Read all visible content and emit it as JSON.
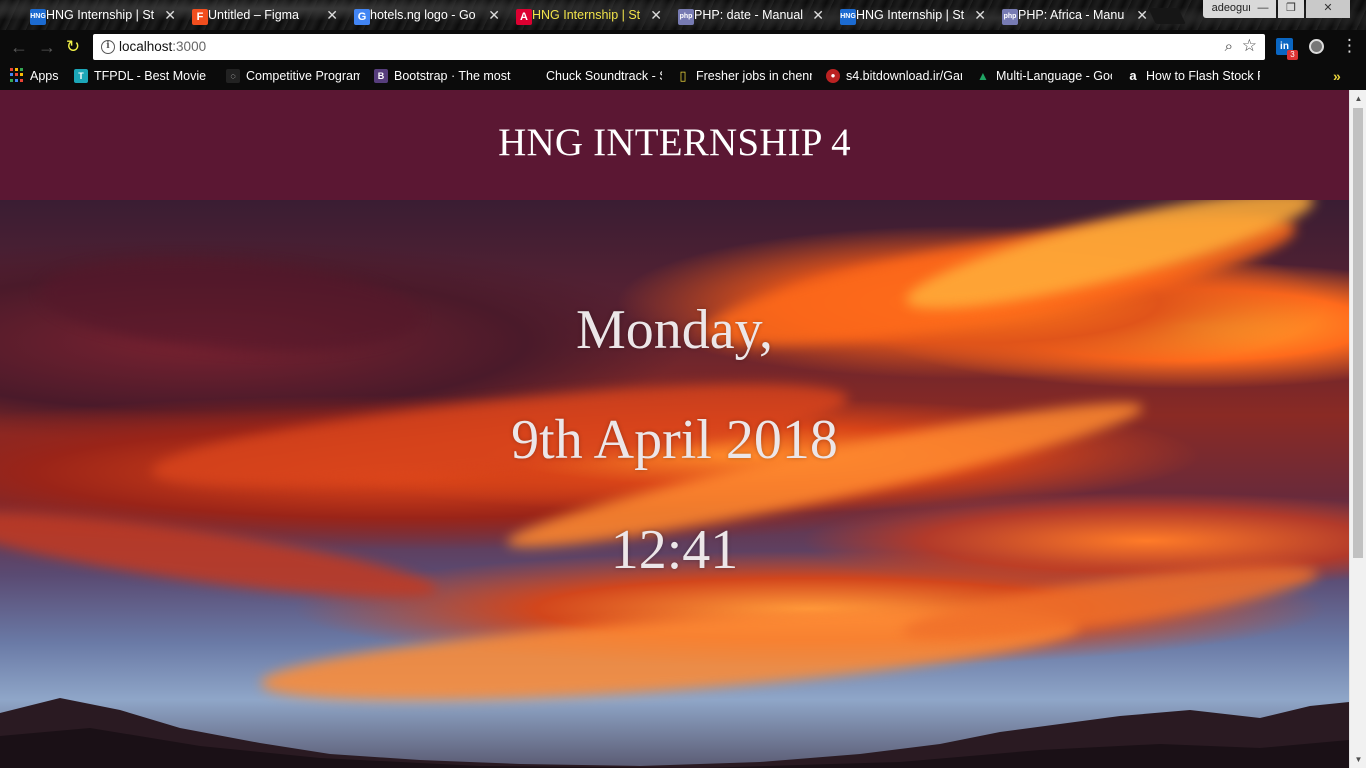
{
  "browser": {
    "tabs": [
      {
        "title": "HNG Internship | St",
        "favicon": "hng-favicon",
        "fav_color": "#1c6bd1",
        "fav_text": "HNG",
        "active": false
      },
      {
        "title": "Untitled – Figma",
        "favicon": "figma-icon",
        "fav_color": "#f24e1e",
        "fav_text": "F",
        "active": false
      },
      {
        "title": "hotels.ng logo - Go",
        "favicon": "google-icon",
        "fav_color": "#4285f4",
        "fav_text": "G",
        "active": false
      },
      {
        "title": "HNG Internship | St",
        "favicon": "angular-icon",
        "fav_color": "#dd0031",
        "fav_text": "A",
        "active": true
      },
      {
        "title": "PHP: date - Manual",
        "favicon": "php-icon",
        "fav_color": "#777bb3",
        "fav_text": "php",
        "active": false
      },
      {
        "title": "HNG Internship | St",
        "favicon": "hng-favicon",
        "fav_color": "#1c6bd1",
        "fav_text": "HNG",
        "active": false
      },
      {
        "title": "PHP: Africa - Manu",
        "favicon": "php-icon",
        "fav_color": "#777bb3",
        "fav_text": "php",
        "active": false
      }
    ],
    "profile_name": "adeogun",
    "url_host": "localhost",
    "url_port": ":3000",
    "extensions": {
      "linkedin_badge": "3"
    },
    "bookmarks": [
      {
        "label": "Apps",
        "icon": "apps-grid-icon"
      },
      {
        "label": "TFPDL - Best Movie D",
        "icon": "tfpdl-icon",
        "color": "#1ca6b8",
        "glyph": "T"
      },
      {
        "label": "Competitive Program",
        "icon": "spinner-icon",
        "color": "#222",
        "glyph": "◌"
      },
      {
        "label": "Bootstrap · The most",
        "icon": "bootstrap-icon",
        "color": "#563d7c",
        "glyph": "B"
      },
      {
        "label": "Chuck Soundtrack - S",
        "icon": "blank-page-icon",
        "color": "transparent",
        "glyph": ""
      },
      {
        "label": "Fresher jobs in chenn",
        "icon": "document-icon",
        "color": "#e8d23c",
        "glyph": "▯"
      },
      {
        "label": "s4.bitdownload.ir/Gar",
        "icon": "bitdownload-icon",
        "color": "#b22",
        "glyph": "●"
      },
      {
        "label": "Multi-Language - Goo",
        "icon": "google-drive-icon",
        "color": "#1fa463",
        "glyph": "▲"
      },
      {
        "label": "How to Flash Stock R",
        "icon": "amazon-icon",
        "color": "transparent",
        "glyph": "a"
      }
    ],
    "bookmarks_more": "»"
  },
  "page": {
    "header_title": "HNG INTERNSHIP 4",
    "day": "Monday,",
    "date": "9th April 2018",
    "time": "12:41",
    "header_color": "#5b1733"
  }
}
